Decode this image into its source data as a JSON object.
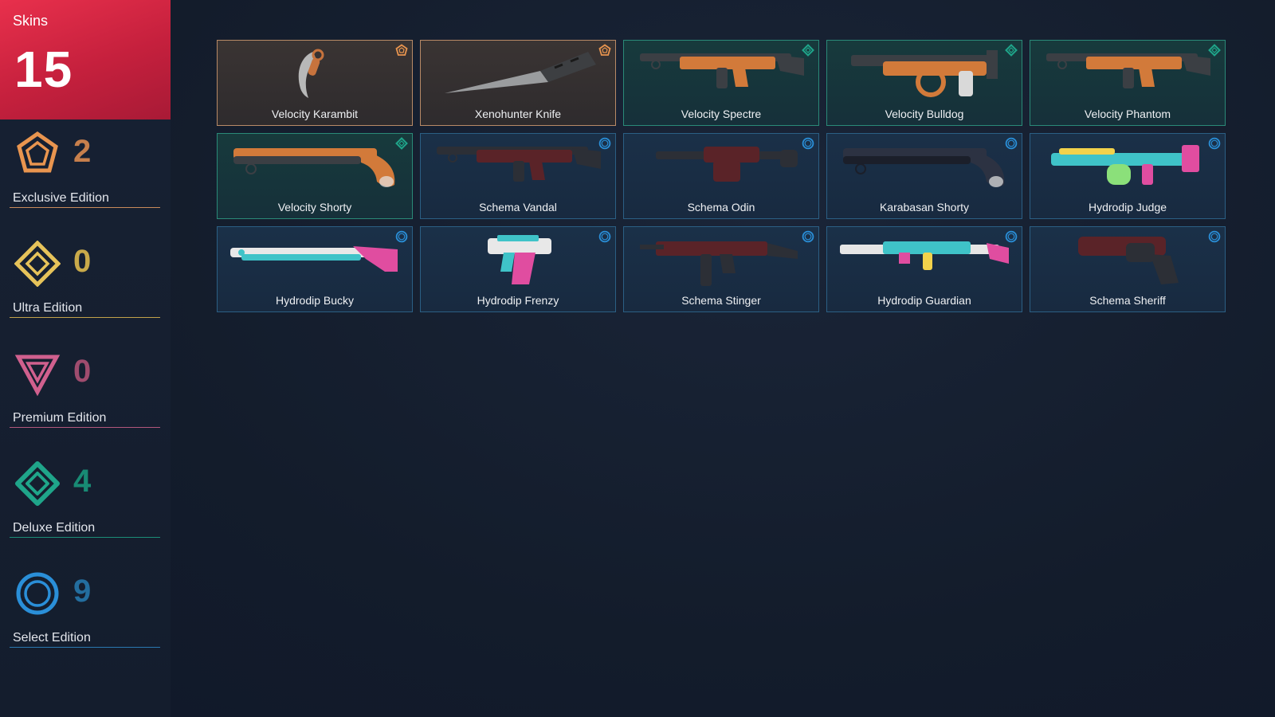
{
  "colors": {
    "accent_red": "#d8263f",
    "exclusive": "#e9954f",
    "ultra": "#e6c35a",
    "premium": "#d0608e",
    "deluxe": "#1fa58a",
    "select": "#2a8fd8"
  },
  "summary": {
    "label": "Skins",
    "count": "15"
  },
  "editions": [
    {
      "label": "Exclusive Edition",
      "count": "2",
      "icon": "exclusive-edition-icon"
    },
    {
      "label": "Ultra Edition",
      "count": "0",
      "icon": "ultra-edition-icon"
    },
    {
      "label": "Premium Edition",
      "count": "0",
      "icon": "premium-edition-icon"
    },
    {
      "label": "Deluxe Edition",
      "count": "4",
      "icon": "deluxe-edition-icon"
    },
    {
      "label": "Select Edition",
      "count": "9",
      "icon": "select-edition-icon"
    }
  ],
  "skins": [
    {
      "name": "Velocity Karambit",
      "tier": "exclusive",
      "weapon": "karambit"
    },
    {
      "name": "Xenohunter Knife",
      "tier": "exclusive",
      "weapon": "knife"
    },
    {
      "name": "Velocity Spectre",
      "tier": "deluxe",
      "weapon": "smg"
    },
    {
      "name": "Velocity Bulldog",
      "tier": "deluxe",
      "weapon": "bulldog"
    },
    {
      "name": "Velocity Phantom",
      "tier": "deluxe",
      "weapon": "rifle"
    },
    {
      "name": "Velocity Shorty",
      "tier": "deluxe",
      "weapon": "shorty"
    },
    {
      "name": "Schema Vandal",
      "tier": "select",
      "weapon": "rifle"
    },
    {
      "name": "Schema Odin",
      "tier": "select",
      "weapon": "lmg"
    },
    {
      "name": "Karabasan Shorty",
      "tier": "select",
      "weapon": "shorty"
    },
    {
      "name": "Hydrodip Judge",
      "tier": "select",
      "weapon": "judge"
    },
    {
      "name": "Hydrodip Bucky",
      "tier": "select",
      "weapon": "shotgun"
    },
    {
      "name": "Hydrodip Frenzy",
      "tier": "select",
      "weapon": "pistol"
    },
    {
      "name": "Schema Stinger",
      "tier": "select",
      "weapon": "smg-compact"
    },
    {
      "name": "Hydrodip Guardian",
      "tier": "select",
      "weapon": "rifle-long"
    },
    {
      "name": "Schema Sheriff",
      "tier": "select",
      "weapon": "revolver"
    }
  ]
}
